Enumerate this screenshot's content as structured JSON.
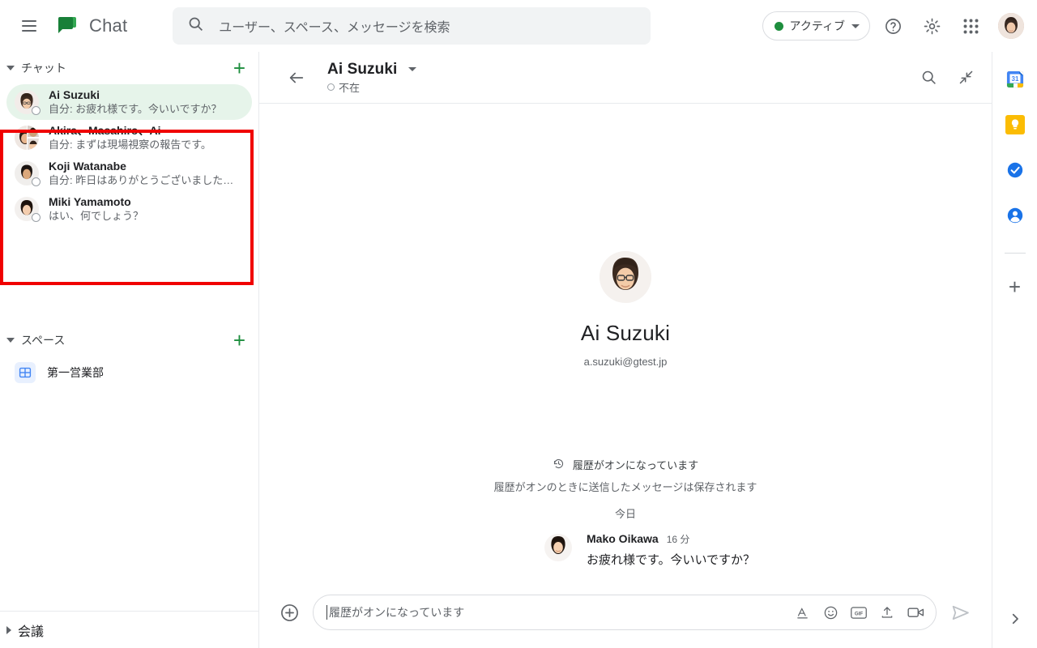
{
  "topbar": {
    "menu_icon": "hamburger-menu-icon",
    "app_name": "Chat",
    "logo_icon": "google-chat-logo",
    "search": {
      "icon": "search-icon",
      "placeholder": "ユーザー、スペース、メッセージを検索",
      "value": ""
    },
    "status": {
      "label": "アクティブ",
      "color": "#1e8e3e",
      "caret_icon": "chevron-down-icon"
    },
    "help_icon": "help-circle-icon",
    "settings_icon": "gear-icon",
    "apps_icon": "apps-grid-icon",
    "account_avatar": "user-avatar"
  },
  "sidebar": {
    "chat_section": {
      "label": "チャット",
      "expanded": true,
      "add_label": "+",
      "items": [
        {
          "name": "Ai Suzuki",
          "snippet": "自分: お疲れ様です。今いいですか？",
          "selected": true,
          "presence": "away"
        },
        {
          "name": "Akira、Masahiro、Ai",
          "snippet": "自分: まずは現場視察の報告です。",
          "selected": false,
          "presence": "group"
        },
        {
          "name": "Koji Watanabe",
          "snippet": "自分: 昨日はありがとうございました…",
          "selected": false,
          "presence": "away"
        },
        {
          "name": "Miki Yamamoto",
          "snippet": "はい、何でしょう？",
          "selected": false,
          "presence": "away"
        }
      ]
    },
    "spaces_section": {
      "label": "スペース",
      "expanded": true,
      "add_label": "+",
      "items": [
        {
          "name": "第一営業部",
          "icon": "space-icon"
        }
      ]
    },
    "meet_section": {
      "label": "会議",
      "expanded": false
    },
    "highlight_color": "#f00000"
  },
  "conversation": {
    "back_icon": "arrow-left-icon",
    "title": "Ai Suzuki",
    "title_caret_icon": "chevron-down-icon",
    "status": "不在",
    "search_icon": "search-icon",
    "collapse_icon": "collapse-arrows-icon",
    "profile": {
      "name": "Ai Suzuki",
      "email": "a.suzuki@gtest.jp",
      "avatar": "contact-avatar"
    },
    "history": {
      "icon": "history-clock-icon",
      "title": "履歴がオンになっています",
      "subtitle": "履歴がオンのときに送信したメッセージは保存されます"
    },
    "day_divider": "今日",
    "messages": [
      {
        "author": "Mako Oikawa",
        "time": "16 分",
        "text": "お疲れ様です。今いいですか？",
        "avatar": "sender-avatar"
      }
    ],
    "composer": {
      "add_icon": "plus-circle-icon",
      "placeholder": "履歴がオンになっています",
      "value": "",
      "icons": [
        {
          "name": "format-text-icon",
          "glyph": "A"
        },
        {
          "name": "emoji-icon",
          "glyph": "☺"
        },
        {
          "name": "gif-icon",
          "glyph": "GIF"
        },
        {
          "name": "upload-icon",
          "glyph": "↥"
        },
        {
          "name": "video-icon",
          "glyph": "▭"
        }
      ],
      "send_icon": "send-icon"
    }
  },
  "rail": {
    "items": [
      {
        "name": "calendar-icon",
        "label": "31"
      },
      {
        "name": "keep-icon",
        "label": ""
      },
      {
        "name": "tasks-icon",
        "label": ""
      },
      {
        "name": "contacts-icon",
        "label": ""
      }
    ],
    "add_label": "+",
    "expand_icon": "chevron-right-icon"
  }
}
